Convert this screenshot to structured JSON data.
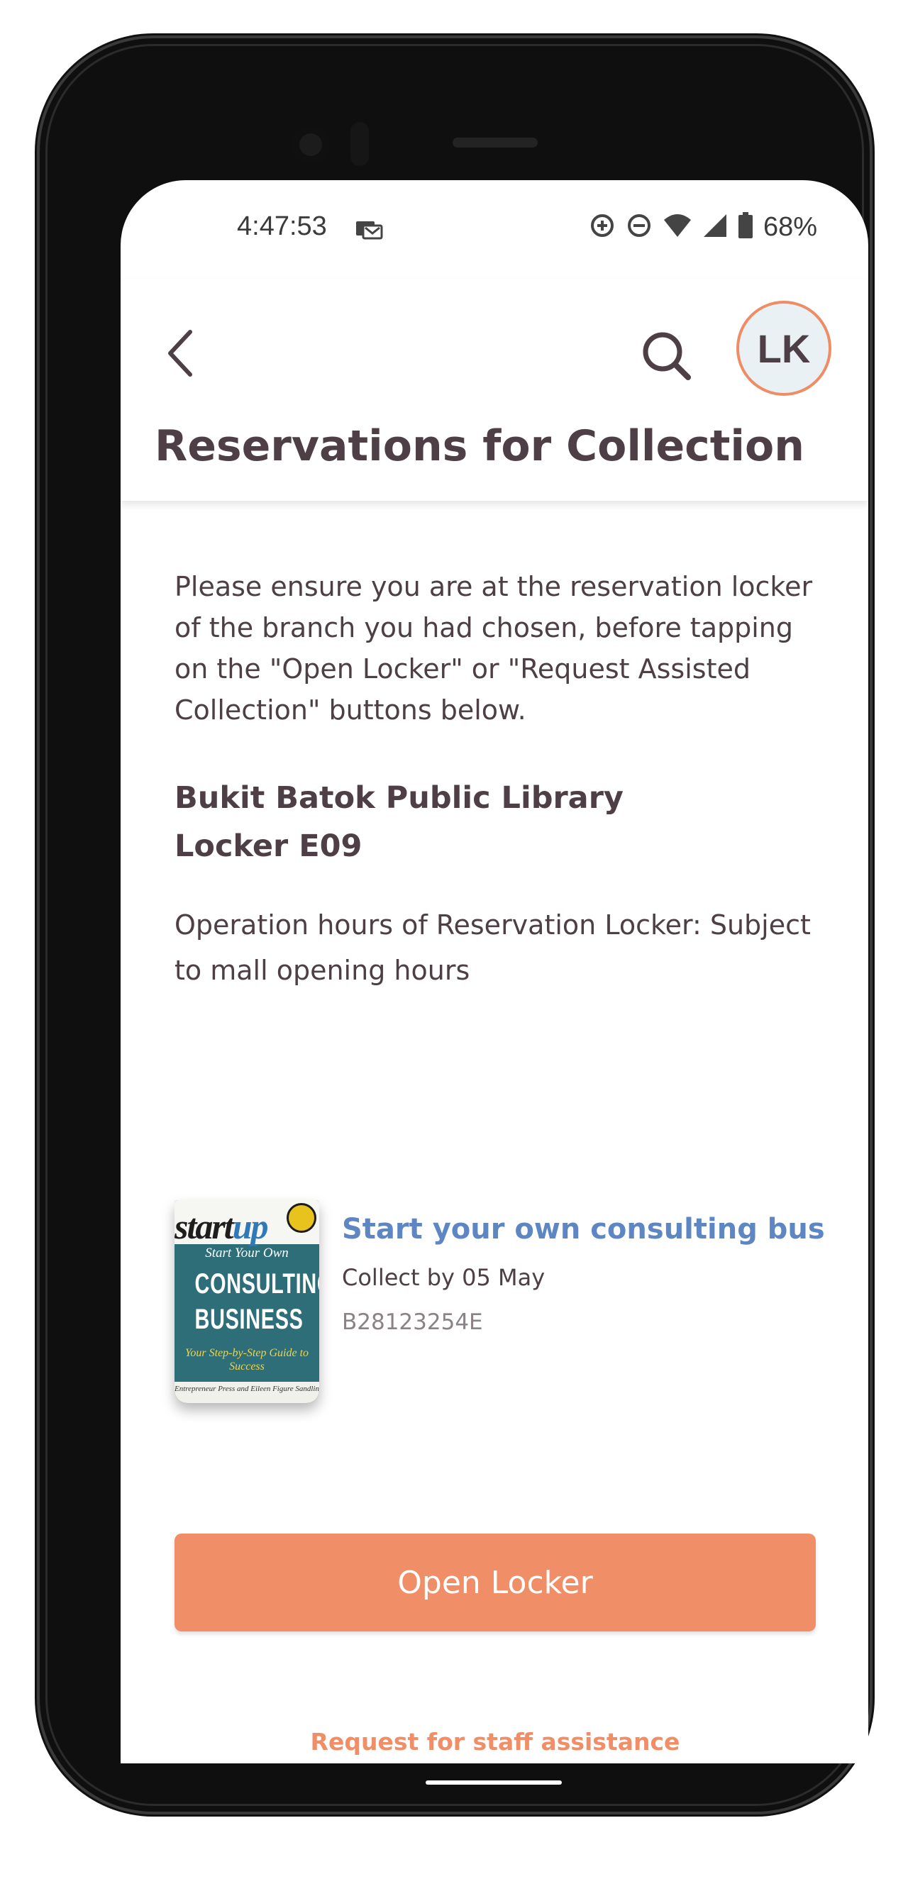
{
  "status_bar": {
    "time": "4:47:53",
    "battery": "68%"
  },
  "header": {
    "title": "Reservations for Collection",
    "avatar_initials": "LK"
  },
  "main": {
    "instructions": "Please ensure you are at the reservation locker of the branch you had chosen, before tapping on the \"Open Locker\" or \"Request Assisted Collection\" buttons below.",
    "branch": "Bukit Batok Public Library",
    "locker": "Locker E09",
    "operation_hours": "Operation hours of Reservation Locker: Subject to mall opening hours"
  },
  "book": {
    "title": "Start your own consulting busi...",
    "collect_by": "Collect by 05 May",
    "barcode": "B28123254E",
    "cover": {
      "series_prefix": "start",
      "series_suffix": "up",
      "subtitle": "Start Your Own",
      "main_line1": "CONSULTING",
      "main_line2": "BUSINESS",
      "tagline": "Your Step-by-Step Guide to Success",
      "authors": "Entrepreneur Press and Eileen Figure Sandlin"
    }
  },
  "actions": {
    "open_locker": "Open Locker",
    "staff_assistance": "Request for staff assistance"
  },
  "colors": {
    "accent": "#ef8e67",
    "title_text": "#4d3f45",
    "link_blue": "#5d86c3"
  }
}
